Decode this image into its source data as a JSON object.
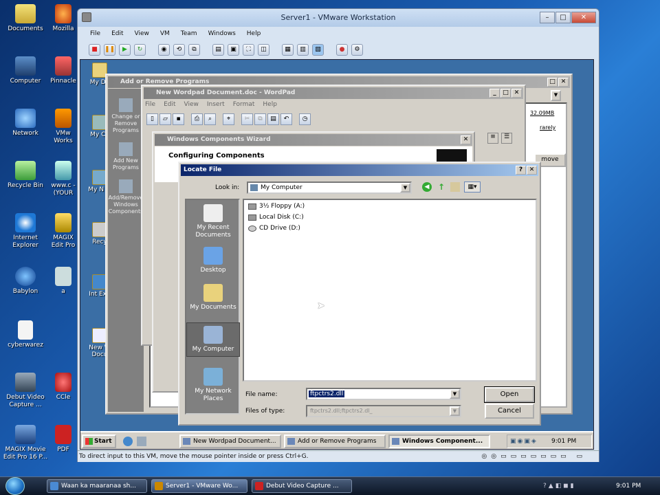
{
  "host": {
    "desktop_icons": [
      {
        "label": "Documents",
        "icon": "documents-folder-icon"
      },
      {
        "label": "Computer",
        "icon": "computer-icon"
      },
      {
        "label": "Network",
        "icon": "network-icon"
      },
      {
        "label": "Recycle Bin",
        "icon": "recycle-bin-icon"
      },
      {
        "label": "Internet Explorer",
        "icon": "internet-explorer-icon"
      },
      {
        "label": "Babylon",
        "icon": "babylon-icon"
      },
      {
        "label": "cyberwarez",
        "icon": "text-file-icon"
      },
      {
        "label": "Debut Video Capture ...",
        "icon": "debut-video-icon"
      },
      {
        "label": "MAGIX Movie Edit Pro 16 P...",
        "icon": "magix-icon"
      }
    ],
    "desktop_icons_col2": [
      {
        "label": "Mozilla",
        "icon": "firefox-icon"
      },
      {
        "label": "Pinnacle",
        "icon": "pinnacle-icon"
      },
      {
        "label": "VMw Works",
        "icon": "vmware-icon"
      },
      {
        "label": "www.c - (YOUR",
        "icon": "shortcut-icon"
      },
      {
        "label": "MAGIX Edit Pro",
        "icon": "magix-icon"
      },
      {
        "label": "a",
        "icon": "app-icon"
      },
      {
        "label": "CCle",
        "icon": "ccleaner-icon"
      },
      {
        "label": "PDF",
        "icon": "pdf-icon"
      }
    ],
    "taskbar": {
      "items": [
        "Waan ka maaranaa sh...",
        "Server1 - VMware Wo...",
        "Debut Video Capture ..."
      ],
      "clock": "9:01 PM"
    }
  },
  "vmware": {
    "title": "Server1 - VMware Workstation",
    "menu": [
      "File",
      "Edit",
      "View",
      "VM",
      "Team",
      "Windows",
      "Help"
    ],
    "status": "To direct input to this VM, move the mouse pointer inside or press Ctrl+G."
  },
  "guest": {
    "desktop_icons": [
      "My Do",
      "My Co",
      "My N Pl",
      "Recy",
      "Int Exp",
      "New W Docu"
    ],
    "add_remove": {
      "title": "Add or Remove Programs",
      "side": [
        "Change or Remove Programs",
        "Add New Programs",
        "Add/Remove Windows Components"
      ],
      "size_value": "32.09MB",
      "used_value": "rarely",
      "remove_label": "move"
    },
    "wordpad": {
      "title": "New Wordpad Document.doc - WordPad",
      "menu": [
        "File",
        "Edit",
        "View",
        "Insert",
        "Format",
        "Help"
      ]
    },
    "wizard": {
      "title": "Windows Components Wizard",
      "heading": "Configuring Components"
    },
    "locate_file": {
      "title": "Locate File",
      "look_in_label": "Look in:",
      "look_in_value": "My Computer",
      "places": [
        "My Recent Documents",
        "Desktop",
        "My Documents",
        "My Computer",
        "My Network Places"
      ],
      "drives": [
        "3½ Floppy (A:)",
        "Local Disk (C:)",
        "CD Drive (D:)"
      ],
      "file_name_label": "File name:",
      "file_name_value": "ftpctrs2.dll",
      "files_of_type_label": "Files of type:",
      "files_of_type_value": "ftpctrs2.dll;ftpctrs2.dl_",
      "open_label": "Open",
      "cancel_label": "Cancel"
    },
    "taskbar": {
      "start": "Start",
      "items": [
        "New Wordpad Document...",
        "Add or Remove Programs",
        "Windows Component..."
      ],
      "clock": "9:01 PM"
    }
  }
}
